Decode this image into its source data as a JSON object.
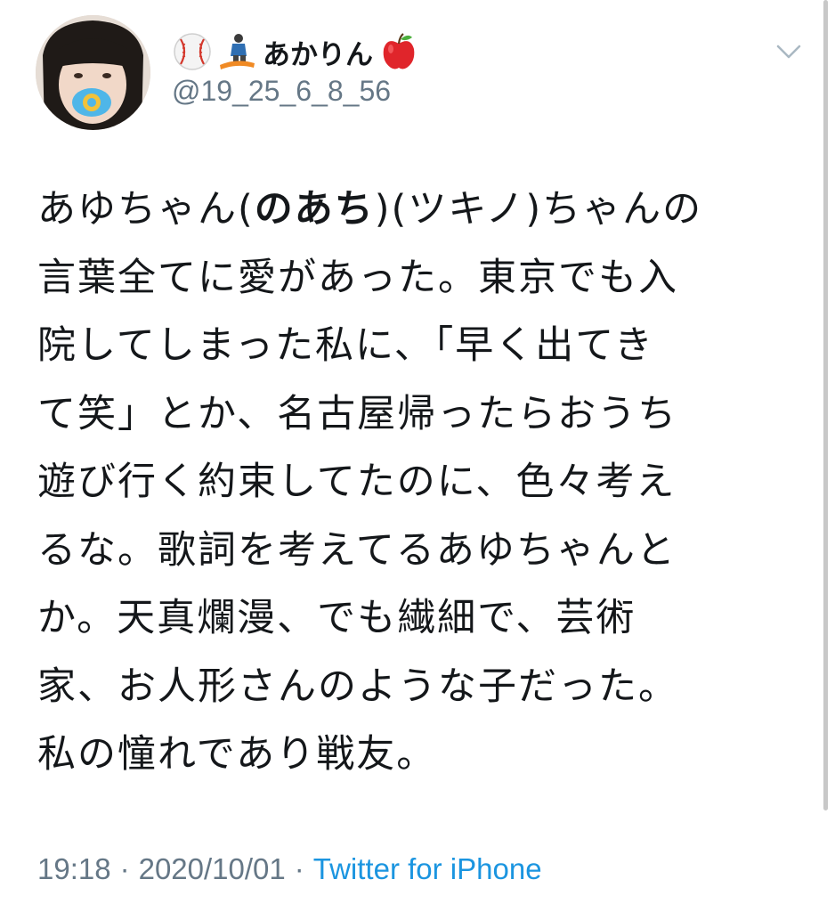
{
  "tweet": {
    "user": {
      "display_name": "あかりん",
      "handle": "@19_25_6_8_56",
      "name_emojis": [
        "baseball-icon",
        "snowboarder-icon",
        "red-apple-icon"
      ]
    },
    "text_lines": [
      {
        "pre": "あゆちゃん(",
        "bold": "のあち",
        "post": ")(ツキノ)ちゃんの"
      },
      {
        "pre": "言葉全てに愛があった。東京でも入",
        "bold": "",
        "post": ""
      },
      {
        "pre": "院してしまった私に、「早く出てき",
        "bold": "",
        "post": ""
      },
      {
        "pre": "て笑」とか、名古屋帰ったらおうち",
        "bold": "",
        "post": ""
      },
      {
        "pre": "遊び行く約束してたのに、色々考え",
        "bold": "",
        "post": ""
      },
      {
        "pre": "るな。歌詞を考えてるあゆちゃんと",
        "bold": "",
        "post": ""
      },
      {
        "pre": "か。天真爛漫、でも繊細で、芸術",
        "bold": "",
        "post": ""
      },
      {
        "pre": "家、お人形さんのような子だった。",
        "bold": "",
        "post": ""
      },
      {
        "pre": "私の憧れであり戦友。",
        "bold": "",
        "post": ""
      }
    ],
    "time": "19:18",
    "separator": "·",
    "date": "2020/10/01",
    "source": "Twitter for iPhone"
  },
  "colors": {
    "text": "#14171a",
    "secondary": "#657786",
    "link": "#1b95e0"
  }
}
